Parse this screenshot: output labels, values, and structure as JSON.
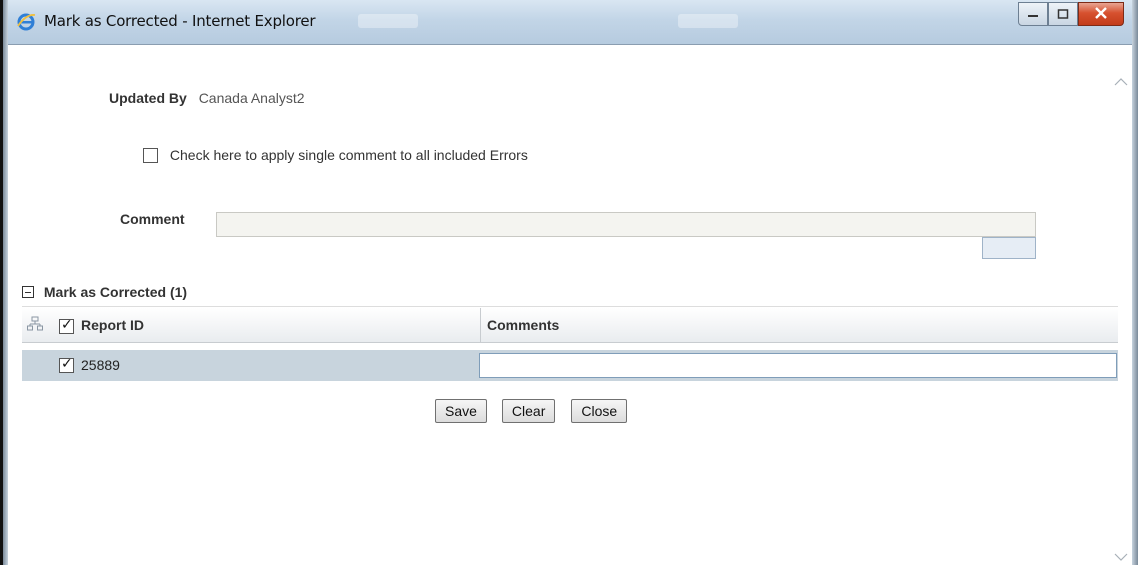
{
  "window": {
    "title": "Mark as Corrected - Internet Explorer",
    "accent": "#c2d5e7",
    "close_color": "#c23b19",
    "icons": [
      "ie-logo-icon",
      "minimize-icon",
      "maximize-icon",
      "close-icon"
    ]
  },
  "form": {
    "updated_by_label": "Updated By",
    "updated_by_value": "Canada Analyst2",
    "apply_all_label": "Check here to apply single comment to all included Errors",
    "apply_all_checked": false,
    "comment_label": "Comment",
    "comment_value": ""
  },
  "section": {
    "title": "Mark as Corrected (1)",
    "collapse_icon": "minus-icon"
  },
  "grid": {
    "columns": [
      "Report ID",
      "Comments"
    ],
    "header_checked": true,
    "rows": [
      {
        "checked": true,
        "report_id": "25889",
        "comment": ""
      }
    ],
    "row_color": "#c8d4dd"
  },
  "buttons": {
    "save": "Save",
    "clear": "Clear",
    "close": "Close"
  }
}
